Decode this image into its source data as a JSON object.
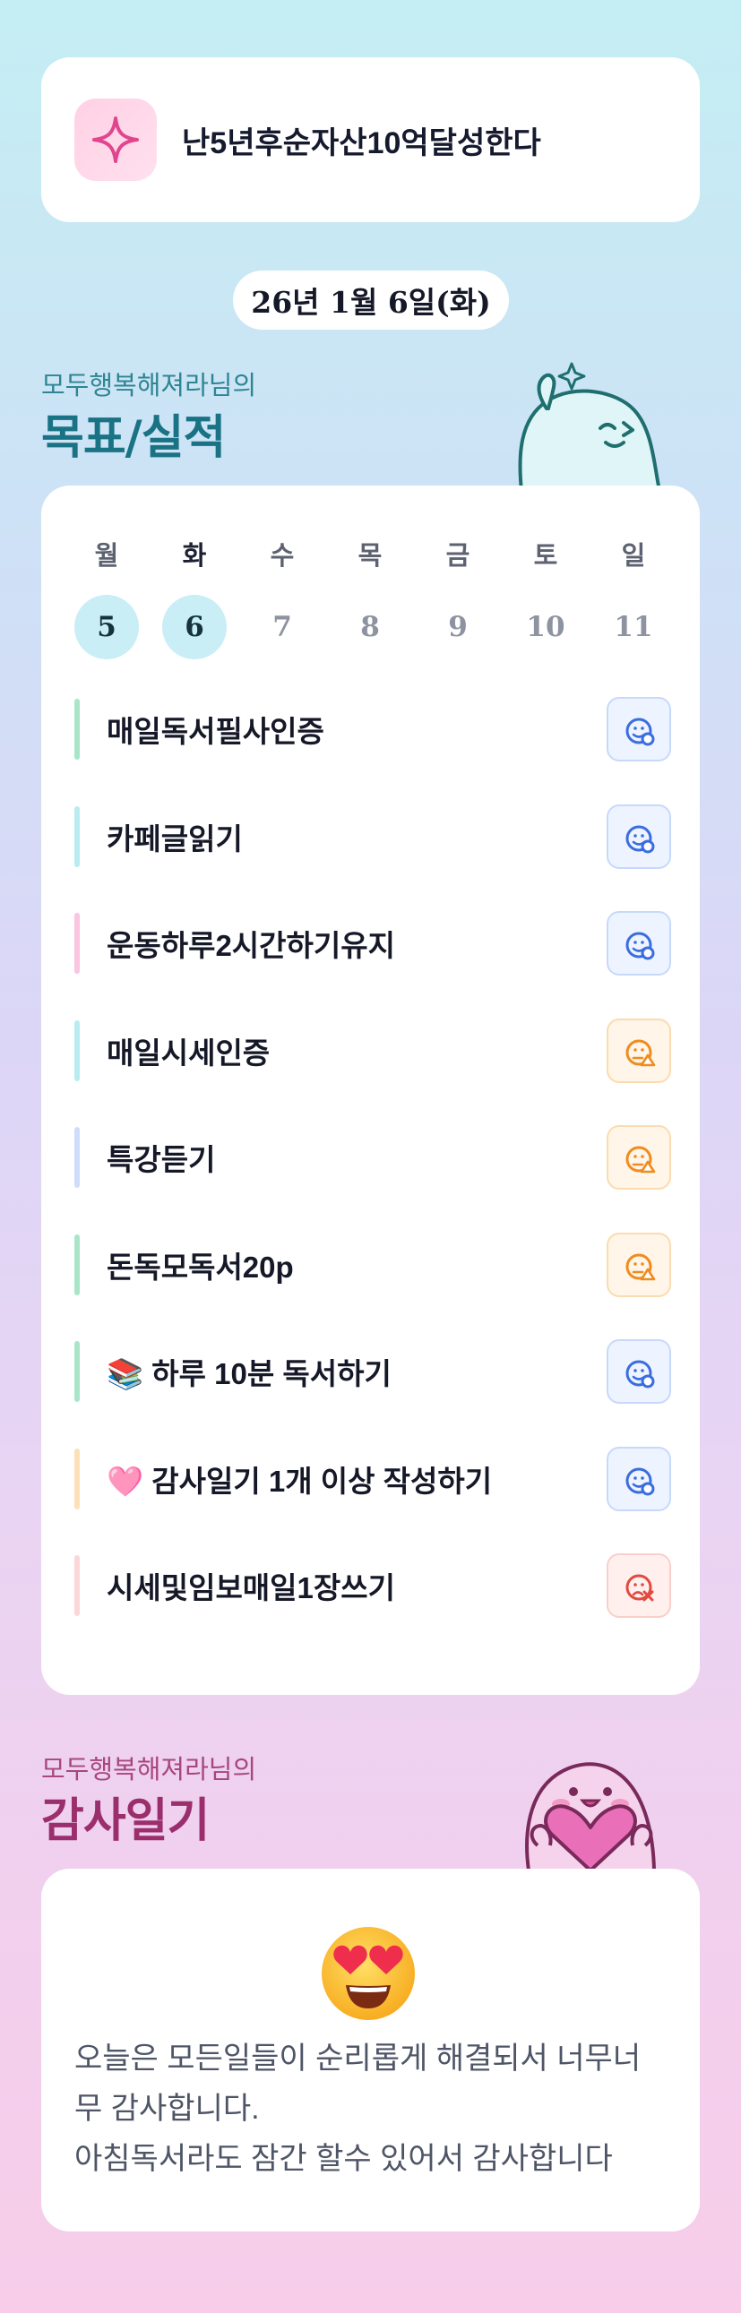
{
  "goal": {
    "text": "난5년후순자산10억달성한다",
    "icon": "sparkle-icon"
  },
  "date": "26년 1월 6일(화)",
  "record_section": {
    "user": "모두행복해져라님의",
    "title": "목표/실적"
  },
  "week": [
    {
      "dow": "월",
      "num": "5",
      "selected": true
    },
    {
      "dow": "화",
      "num": "6",
      "selected": true
    },
    {
      "dow": "수",
      "num": "7",
      "selected": false
    },
    {
      "dow": "목",
      "num": "8",
      "selected": false
    },
    {
      "dow": "금",
      "num": "9",
      "selected": false
    },
    {
      "dow": "토",
      "num": "10",
      "selected": false
    },
    {
      "dow": "일",
      "num": "11",
      "selected": false
    }
  ],
  "tasks": [
    {
      "label": "매일독서필사인증",
      "bar_color": "#a9e6c9",
      "status": "done"
    },
    {
      "label": "카페글읽기",
      "bar_color": "#b9ecf1",
      "status": "done"
    },
    {
      "label": "운동하루2시간하기유지",
      "bar_color": "#fbc4df",
      "status": "done"
    },
    {
      "label": "매일시세인증",
      "bar_color": "#b9ecf1",
      "status": "partial"
    },
    {
      "label": "특강듣기",
      "bar_color": "#cfdcfb",
      "status": "partial"
    },
    {
      "label": "돈독모독서20p",
      "bar_color": "#a9e6c9",
      "status": "partial"
    },
    {
      "label": "📚 하루 10분 독서하기",
      "bar_color": "#a9e6c9",
      "status": "done"
    },
    {
      "label": "🩷 감사일기 1개 이상 작성하기",
      "bar_color": "#fce1b8",
      "status": "done"
    },
    {
      "label": "시세및임보매일1장쓰기",
      "bar_color": "#fcd7da",
      "status": "fail"
    }
  ],
  "diary_section": {
    "user": "모두행복해져라님의",
    "title": "감사일기"
  },
  "diary": {
    "emoji": "heart-eyes-emoji",
    "lines": [
      "오늘은 모든일들이 순리롭게 해결되서 너무너",
      "무 감사합니다.",
      "아침독서라도 잠간 할수 있어서 감사합니다"
    ]
  },
  "colors": {
    "record_title": "#1f7a8c",
    "record_sub": "#3a8a98",
    "diary_title": "#9b2f6d",
    "diary_sub": "#a8477e",
    "done": "#3a6de0",
    "partial": "#f08c1f",
    "fail": "#e24a40"
  }
}
